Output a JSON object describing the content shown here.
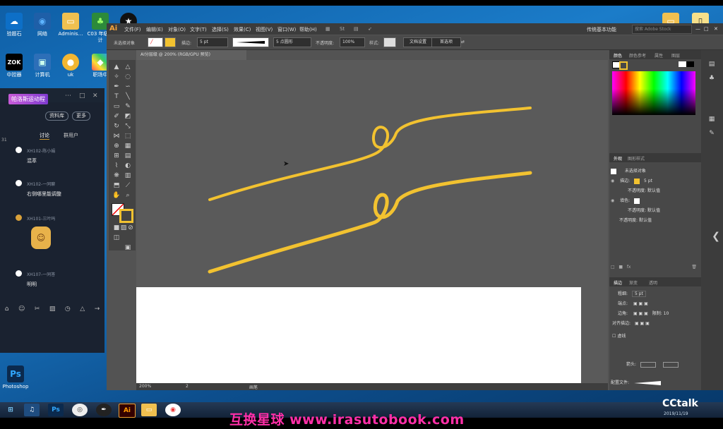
{
  "desktop": {
    "icons": [
      {
        "label": "验题石",
        "icon": "cloud-icon",
        "color": "#ffffff"
      },
      {
        "label": "网络",
        "icon": "network-icon",
        "color": "#5db3ff"
      },
      {
        "label": "Adminis…",
        "icon": "folder-icon",
        "color": "#f0c050"
      },
      {
        "label": "C03 年级设计",
        "icon": "tree-icon",
        "color": "#3aa844"
      },
      {
        "label": "",
        "icon": "star-icon",
        "color": "#222222"
      },
      {
        "label": "中控器",
        "icon": "zok-icon",
        "color": "#000000"
      },
      {
        "label": "计算机",
        "icon": "computer-icon",
        "color": "#5db3ff"
      },
      {
        "label": "uk",
        "icon": "ball-icon",
        "color": "#ffcc33"
      },
      {
        "label": "职场中",
        "icon": "color-icon",
        "color": "#ff5566"
      },
      {
        "label": "Photoshop",
        "icon": "photoshop-icon",
        "color": "#0b2a4e"
      }
    ]
  },
  "chat": {
    "brand": "帕洛斯运动程",
    "pill_left": "资料库",
    "pill_right": "更多",
    "tab_discuss": "讨论",
    "tab_members": "群用户",
    "side_num": "31",
    "messages": [
      {
        "who": "XH102-陈小娟",
        "text": "混萃"
      },
      {
        "who": "XH102-一同聊",
        "text": "右侧哪里能调整"
      },
      {
        "who": "XH101-三叶吗",
        "text": ""
      },
      {
        "who": "XH107-一同答",
        "text": "明明"
      }
    ]
  },
  "ai": {
    "logo": "Ai",
    "menus": [
      "文件(F)",
      "编辑(E)",
      "对象(O)",
      "文字(T)",
      "选择(S)",
      "效果(C)",
      "视图(V)",
      "窗口(W)",
      "帮助(H)"
    ],
    "workspace": "传统基本功能",
    "search_placeholder": "搜索 Adobe Stock",
    "ctrl": {
      "selection": "未选择对象",
      "stroke_label": "描边:",
      "stroke_value": "5 pt",
      "brush_label": "5 点圆形",
      "opacity_label": "不透明度:",
      "opacity_value": "100%",
      "style_label": "样式:",
      "doc_setup": "文档设置",
      "prefs": "首选项"
    },
    "doc_tab": "AI分层级 @ 200% (RGB/GPU 预览)",
    "status": {
      "zoom": "200%",
      "page": "2",
      "tool": "画笔"
    },
    "stroke_color": "#f2c230"
  },
  "panels": {
    "color_tabs": [
      "颜色",
      "颜色参考",
      "属性",
      "图层"
    ],
    "appearance_tabs": [
      "外观",
      "图形样式"
    ],
    "appearance_rows": [
      {
        "label": "未选择对象"
      },
      {
        "label": "描边:",
        "value": "5 pt"
      },
      {
        "label": "不透明度:",
        "value": "默认值"
      },
      {
        "label": "填色:"
      },
      {
        "label": "不透明度:",
        "value": "默认值"
      },
      {
        "label": "不透明度:",
        "value": "默认值"
      }
    ],
    "stroke_tabs": [
      "描边",
      "渐变",
      "透明"
    ],
    "stroke_rows": [
      {
        "label": "粗细:",
        "value": "5 pt"
      },
      {
        "label": "端点:"
      },
      {
        "label": "边角:",
        "value": "限制: 10"
      },
      {
        "label": "对齐描边:"
      }
    ],
    "dashed_label": "虚线",
    "arrow_label": "箭头:",
    "profile_label": "配置文件:"
  },
  "taskbar": {
    "items": [
      "windows-icon",
      "kugou-icon",
      "photoshop-icon",
      "qq-icon",
      "pen-icon",
      "illustrator-icon",
      "explorer-icon",
      "chrome-icon"
    ],
    "labels": [
      "",
      "",
      "Ps",
      "",
      "",
      "Ai",
      "",
      ""
    ],
    "time": "2019/11/19"
  },
  "watermark": "互换星球 www.irasutobook.com",
  "cctalk": "CCtalk"
}
